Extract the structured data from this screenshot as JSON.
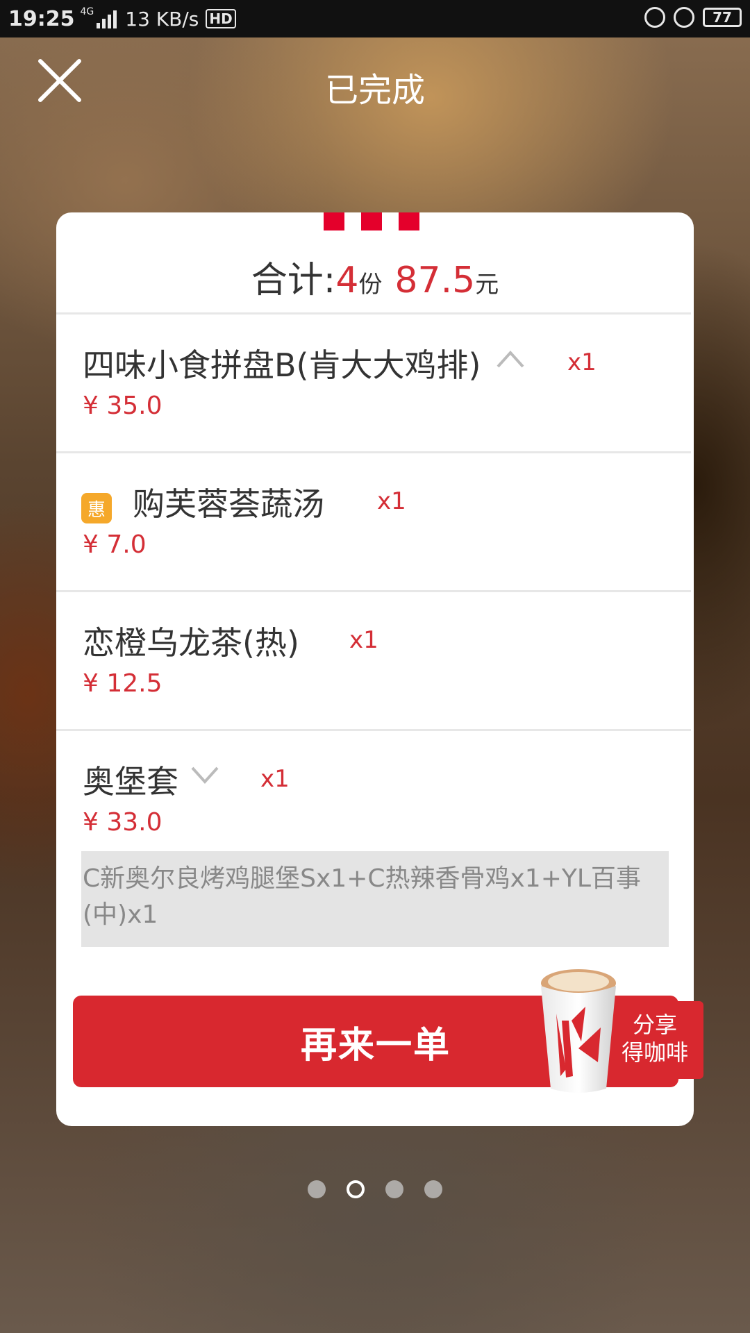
{
  "status_bar": {
    "time": "19:25",
    "network": "4G",
    "speed": "13 KB/s",
    "hd": "HD",
    "battery": "77"
  },
  "header": {
    "title": "已完成",
    "close_icon": "close-icon"
  },
  "summary": {
    "prefix": "合计:",
    "count": "4",
    "count_unit": "份",
    "amount": "87.5",
    "amount_unit": "元"
  },
  "items": [
    {
      "name": "四味小食拼盘B(肯大大鸡排)",
      "qty": "x1",
      "price": "¥ 35.0",
      "chevron": "chevron-up-icon"
    },
    {
      "badge": "惠",
      "name": "购芙蓉荟蔬汤",
      "qty": "x1",
      "price": "¥ 7.0"
    },
    {
      "name": "恋橙乌龙茶(热)",
      "qty": "x1",
      "price": "¥ 12.5"
    },
    {
      "name": "奥堡套",
      "qty": "x1",
      "price": "¥ 33.0",
      "chevron": "chevron-down-icon",
      "detail": "C新奥尔良烤鸡腿堡Sx1+C热辣香骨鸡x1+YL百事(中)x1"
    }
  ],
  "actions": {
    "reorder_label": "再来一单",
    "share_line1": "分享",
    "share_line2": "得咖啡"
  },
  "pagination": {
    "total": 4,
    "active": 2
  },
  "colors": {
    "accent": "#d8282f",
    "badge": "#f5a82a",
    "price": "#d42e36"
  }
}
